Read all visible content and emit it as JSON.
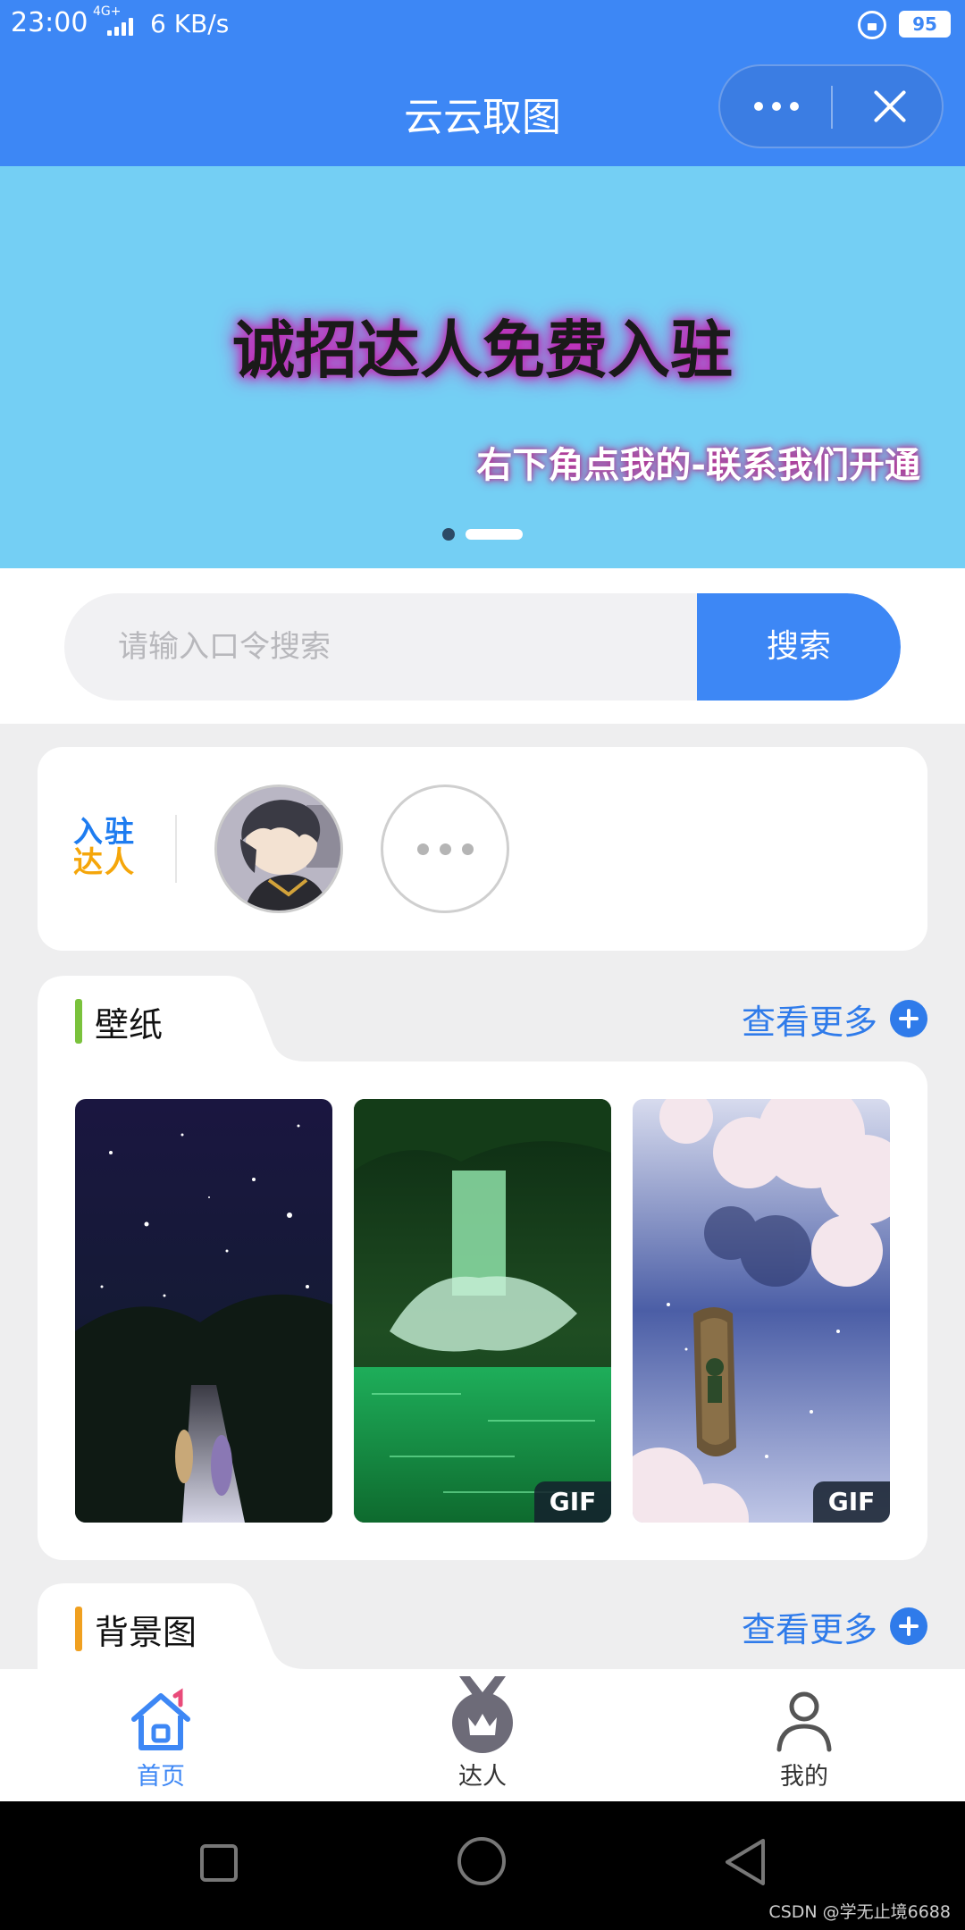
{
  "status_bar": {
    "time": "23:00",
    "network": "4G+",
    "speed": "6 KB/s",
    "battery": "95"
  },
  "header": {
    "title": "云云取图",
    "capsule_icons": [
      "more-icon",
      "close-icon"
    ]
  },
  "banner": {
    "headline": "诚招达人免费入驻",
    "subline": "右下角点我的-联系我们开通",
    "slides": 2,
    "active_slide": 2
  },
  "search": {
    "placeholder": "请输入口令搜索",
    "button_label": "搜索"
  },
  "experts": {
    "logo_line1": "入驻",
    "logo_line2": "达人"
  },
  "sections": [
    {
      "title": "壁纸",
      "more_label": "查看更多",
      "accent_color": "#7ac23c",
      "items": [
        {
          "name": "starry-night-stairs",
          "badge": ""
        },
        {
          "name": "green-waterfall",
          "badge": "GIF"
        },
        {
          "name": "cherry-blossom-boat",
          "badge": "GIF"
        }
      ]
    },
    {
      "title": "背景图",
      "more_label": "查看更多",
      "accent_color": "#f0a020"
    }
  ],
  "tabbar": {
    "items": [
      {
        "label": "首页",
        "icon": "home-icon",
        "active": true
      },
      {
        "label": "达人",
        "icon": "medal-crown-icon",
        "active": false
      },
      {
        "label": "我的",
        "icon": "user-icon",
        "active": false
      }
    ]
  },
  "system_nav": {
    "icons": [
      "recents-icon",
      "home-circle-icon",
      "back-triangle-icon"
    ]
  },
  "watermark": "CSDN @学无止境6688",
  "colors": {
    "primary": "#3d87f5",
    "banner_bg": "#74cff4",
    "page_bg": "#eeeeef",
    "tab_active": "#3d87f5",
    "tab_inactive": "#333333"
  }
}
